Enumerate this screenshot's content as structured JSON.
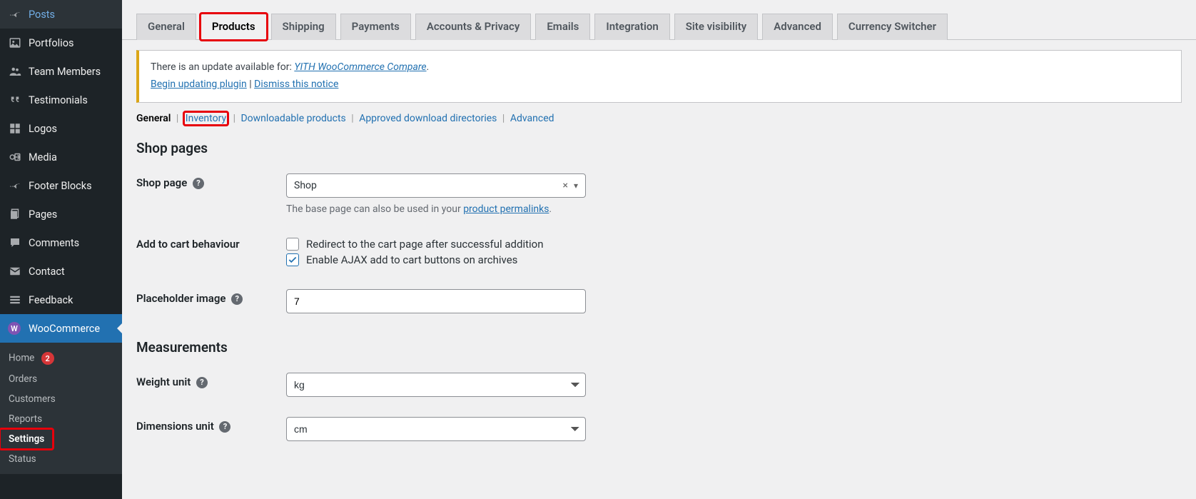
{
  "sidebar": {
    "items": [
      {
        "icon": "📌",
        "label": "Posts"
      },
      {
        "icon": "🖼",
        "label": "Portfolios"
      },
      {
        "icon": "👥",
        "label": "Team Members"
      },
      {
        "icon": "❝",
        "label": "Testimonials"
      },
      {
        "icon": "▦",
        "label": "Logos"
      },
      {
        "icon": "🎞",
        "label": "Media"
      },
      {
        "icon": "📌",
        "label": "Footer Blocks"
      },
      {
        "icon": "🗐",
        "label": "Pages"
      },
      {
        "icon": "💬",
        "label": "Comments"
      },
      {
        "icon": "✉",
        "label": "Contact"
      },
      {
        "icon": "▤",
        "label": "Feedback"
      }
    ],
    "woo": {
      "label": "WooCommerce"
    },
    "submenu": [
      {
        "label": "Home",
        "badge": "2"
      },
      {
        "label": "Orders"
      },
      {
        "label": "Customers"
      },
      {
        "label": "Reports"
      },
      {
        "label": "Settings",
        "current": true
      },
      {
        "label": "Status"
      }
    ]
  },
  "tabs": [
    "General",
    "Products",
    "Shipping",
    "Payments",
    "Accounts & Privacy",
    "Emails",
    "Integration",
    "Site visibility",
    "Advanced",
    "Currency Switcher"
  ],
  "notice": {
    "text_before": "There is an update available for: ",
    "plugin": "YITH WooCommerce Compare",
    "begin": "Begin updating plugin",
    "dismiss": "Dismiss this notice"
  },
  "subtabs": {
    "general": "General",
    "inventory": "Inventory",
    "downloadable": "Downloadable products",
    "approved": "Approved download directories",
    "advanced": "Advanced"
  },
  "sections": {
    "shop_pages": "Shop pages",
    "measurements": "Measurements"
  },
  "fields": {
    "shop_page": {
      "label": "Shop page",
      "value": "Shop",
      "desc_before": "The base page can also be used in your ",
      "desc_link": "product permalinks",
      "desc_after": "."
    },
    "add_to_cart": {
      "label": "Add to cart behaviour",
      "opt1": "Redirect to the cart page after successful addition",
      "opt2": "Enable AJAX add to cart buttons on archives"
    },
    "placeholder": {
      "label": "Placeholder image",
      "value": "7"
    },
    "weight": {
      "label": "Weight unit",
      "value": "kg"
    },
    "dimensions": {
      "label": "Dimensions unit",
      "value": "cm"
    }
  }
}
